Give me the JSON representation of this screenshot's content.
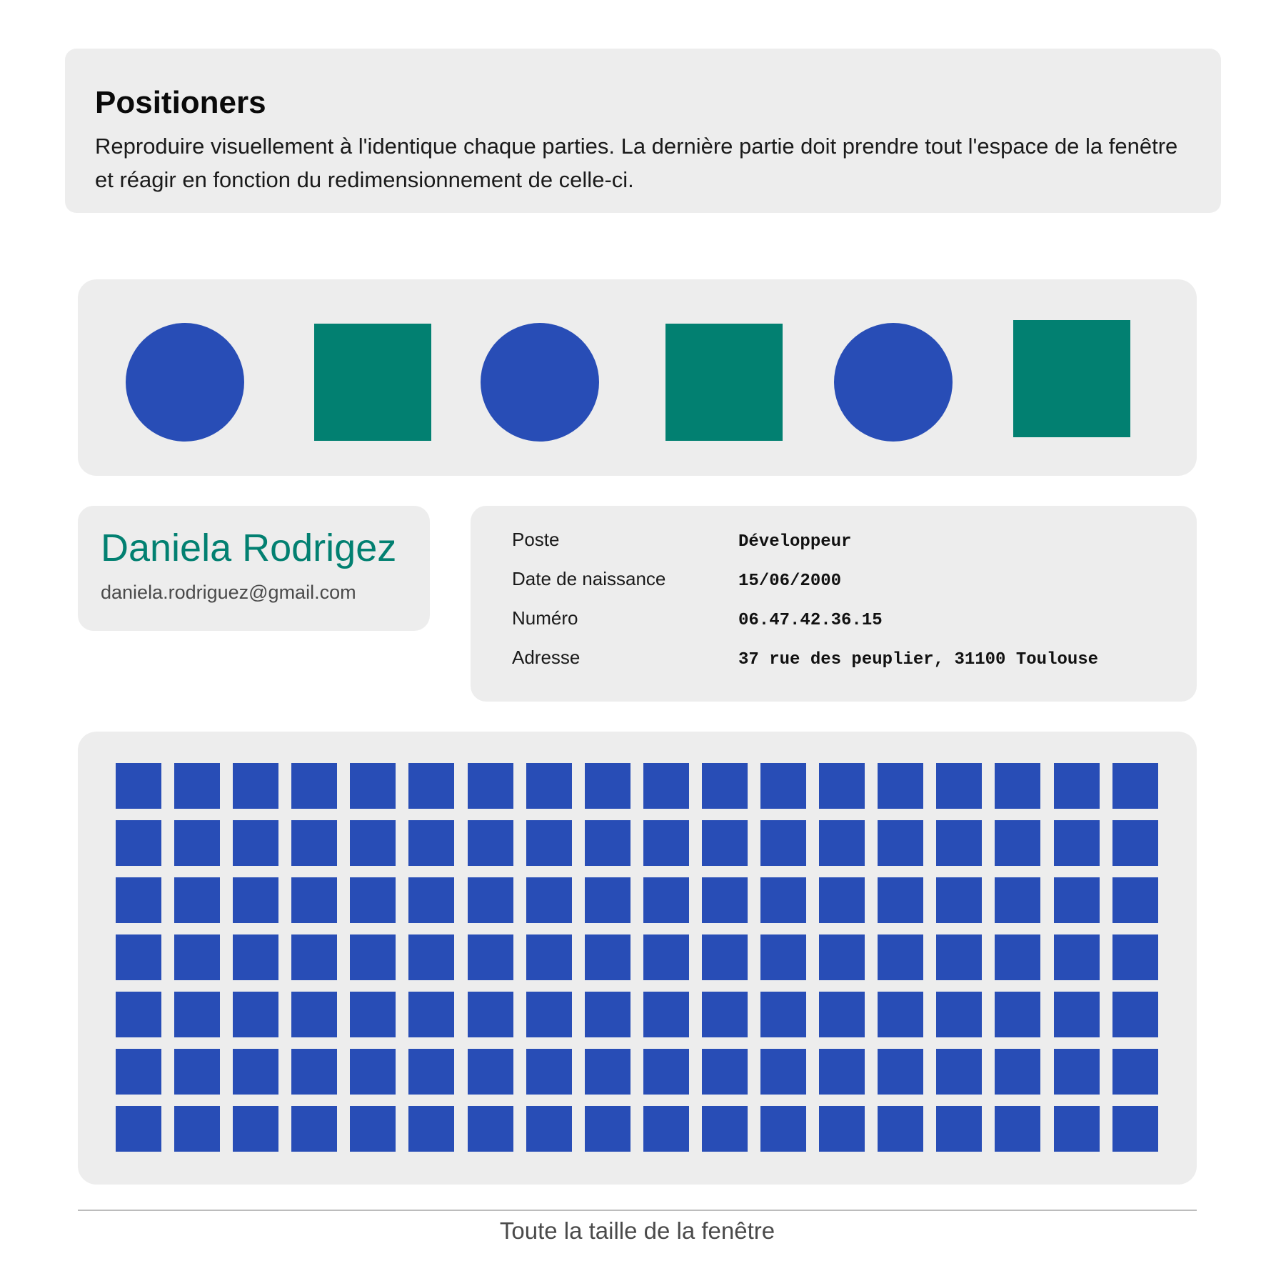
{
  "intro": {
    "title": "Positioners",
    "description": "Reproduire visuellement à l'identique chaque parties.  La dernière partie doit prendre tout l'espace de la fenêtre et réagir en fonction du redimensionnement de celle-ci."
  },
  "shapes": {
    "items": [
      "circle",
      "square",
      "circle",
      "square",
      "circle",
      "square"
    ],
    "colors": {
      "circle": "#284db6",
      "square": "#028071"
    }
  },
  "profile": {
    "name": "Daniela Rodrigez",
    "email": "daniela.rodriguez@gmail.com",
    "name_color": "#028071"
  },
  "info": {
    "rows": [
      {
        "label": "Poste",
        "value": "Développeur"
      },
      {
        "label": "Date de naissance",
        "value": "15/06/2000"
      },
      {
        "label": "Numéro",
        "value": "06.47.42.36.15"
      },
      {
        "label": "Adresse",
        "value": "37 rue des peuplier, 31100 Toulouse"
      }
    ]
  },
  "grid": {
    "rows": 7,
    "columns": 18,
    "color": "#284db6"
  },
  "footer": {
    "caption": "Toute la taille de la fenêtre"
  }
}
